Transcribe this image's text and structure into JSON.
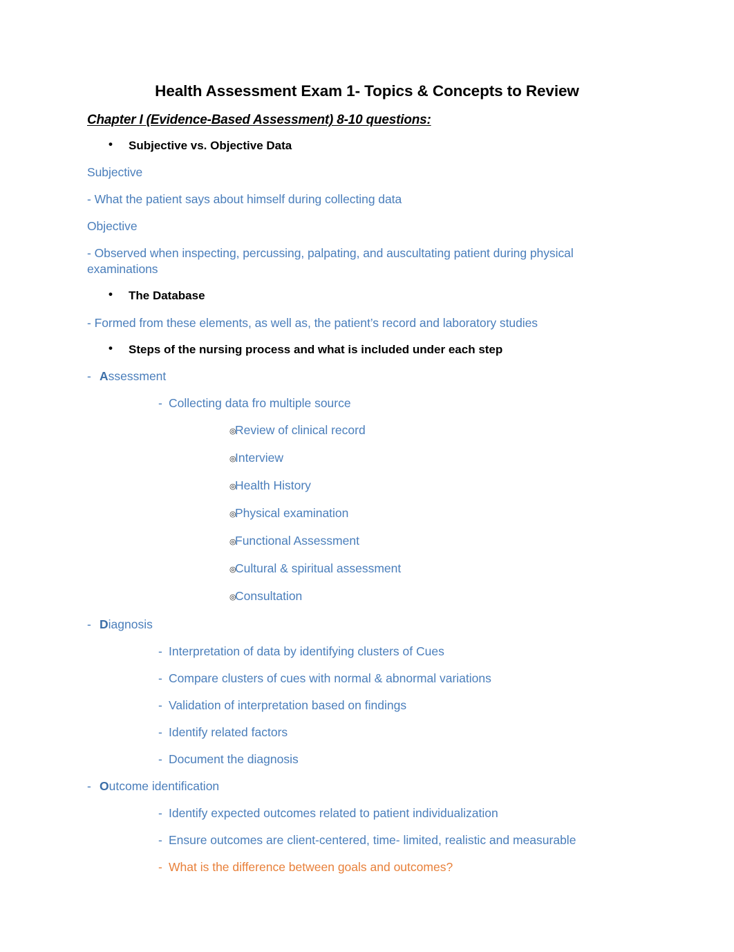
{
  "document": {
    "title": "Health Assessment Exam 1- Topics & Concepts to Review",
    "chapter_heading": "Chapter I (Evidence-Based Assessment) 8-10 questions:",
    "colors": {
      "body_text_blue": "#4A7EBB",
      "accent_cap_blue": "#3C6FA8",
      "highlight_orange": "#E8803A",
      "heading_black": "#000000",
      "page_background": "#FFFFFF"
    },
    "markers": {
      "round_bullet": "•",
      "dash_bullet": "-",
      "bullseye_bullet": "◎"
    },
    "sections": {
      "subjective_objective": {
        "heading": "Subjective vs. Objective Data",
        "subjective_label": "Subjective",
        "subjective_text": "-  What the patient says about himself during collecting data",
        "objective_label": "Objective",
        "objective_text": "- Observed when inspecting, percussing, palpating, and auscultating patient during physical examinations"
      },
      "database": {
        "heading": "The Database",
        "text": "- Formed from these elements, as well as, the patient’s record and laboratory studies"
      },
      "nursing_process": {
        "heading": "Steps of the nursing process and what is included under each step",
        "assessment": {
          "cap": "A",
          "rest": "ssessment",
          "sub_item": "Collecting data fro multiple source",
          "details": [
            "Review of clinical record",
            "Interview",
            "Health History",
            "Physical examination",
            "Functional Assessment",
            "Cultural & spiritual assessment",
            "Consultation"
          ]
        },
        "diagnosis": {
          "cap": "D",
          "rest": "iagnosis",
          "items": [
            "Interpretation of data by identifying clusters of Cues",
            "Compare clusters of cues with normal & abnormal variations",
            "Validation of interpretation based on findings",
            "Identify related factors",
            "Document the diagnosis"
          ]
        },
        "outcome_identification": {
          "cap": "O",
          "rest": "utcome identification",
          "items": [
            "Identify expected outcomes related to patient individualization",
            "Ensure outcomes are client-centered, time- limited, realistic and measurable"
          ],
          "highlighted_item": "What is the difference between goals and outcomes?"
        }
      }
    }
  }
}
